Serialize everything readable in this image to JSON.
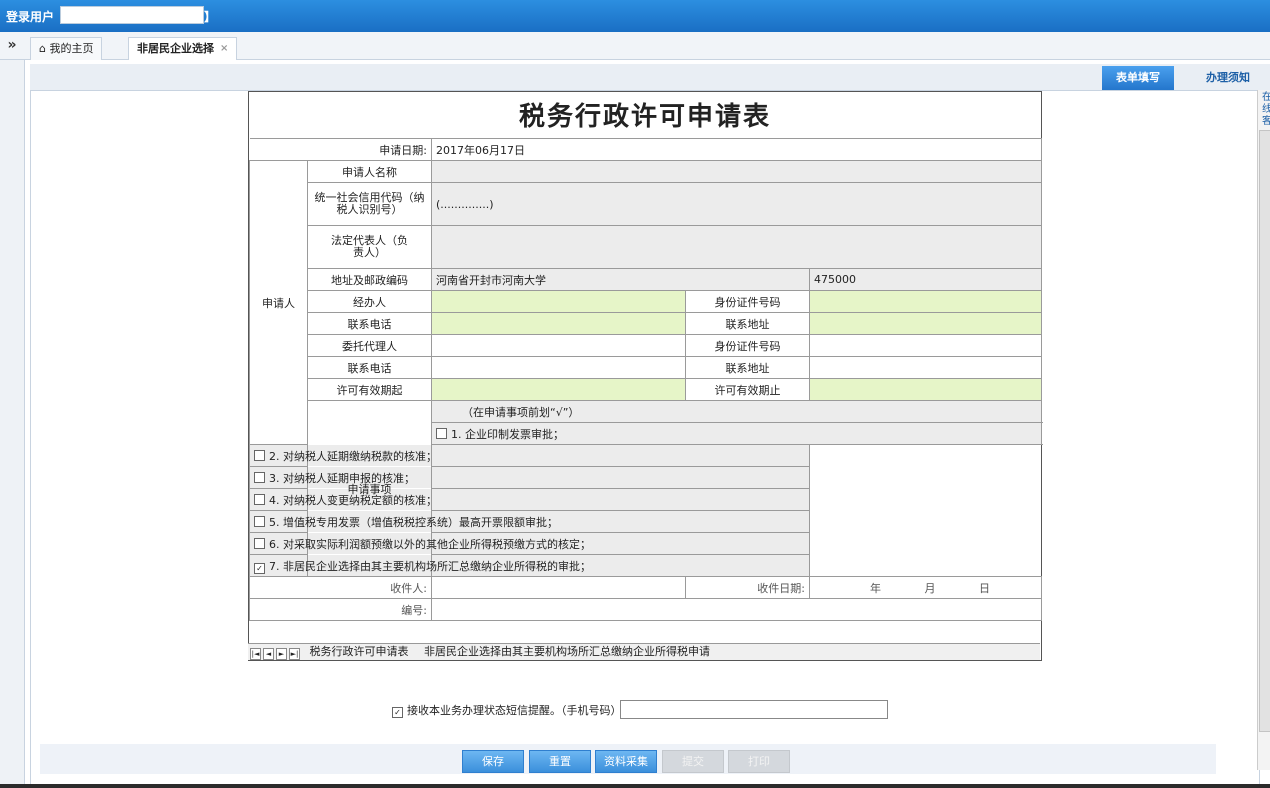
{
  "header": {
    "login_label": "登录用户【",
    "login_close": "】"
  },
  "tabs": [
    {
      "label": "我的主页",
      "icon": "home-icon"
    },
    {
      "label": "非居民企业选择",
      "close": "×"
    }
  ],
  "collapse_glyph": "»",
  "subtabs": [
    {
      "label": "表单填写"
    },
    {
      "label": "办理须知"
    }
  ],
  "side_cut": "在线客",
  "form": {
    "title": "税务行政许可申请表",
    "date_label": "申请日期:",
    "date_value": "2017年06月17日",
    "applicant_section": "申请人",
    "name_label": "申请人名称",
    "credit_label": "统一社会信用代码（纳税人识别号）",
    "credit_value": "(..............)",
    "legal_label": "法定代表人（负责人）",
    "address_label": "地址及邮政编码",
    "address_value": "河南省开封市河南大学",
    "postcode": "475000",
    "handler_label": "经办人",
    "id_label": "身份证件号码",
    "phone_label": "联系电话",
    "contact_addr_label": "联系地址",
    "agent_label": "委托代理人",
    "id_label2": "身份证件号码",
    "phone_label2": "联系电话",
    "contact_addr_label2": "联系地址",
    "valid_from_label": "许可有效期起",
    "valid_to_label": "许可有效期止",
    "matters_section": "申请事项",
    "matters_hint": "（在申请事项前划“√”）",
    "items": [
      {
        "text": "1. 企业印制发票审批；",
        "checked": false
      },
      {
        "text": "2. 对纳税人延期缴纳税款的核准；",
        "checked": false
      },
      {
        "text": "3. 对纳税人延期申报的核准；",
        "checked": false
      },
      {
        "text": "4. 对纳税人变更纳税定额的核准；",
        "checked": false
      },
      {
        "text": "5. 增值税专用发票（增值税税控系统）最高开票限额审批；",
        "checked": false
      },
      {
        "text": "6. 对采取实际利润额预缴以外的其他企业所得税预缴方式的核定；",
        "checked": false
      },
      {
        "text": "7. 非居民企业选择由其主要机构场所汇总缴纳企业所得税的审批；",
        "checked": true
      }
    ],
    "receiver_label": "收件人:",
    "receive_date_label": "收件日期:",
    "year": "年",
    "month": "月",
    "day": "日",
    "number_label": "编号:"
  },
  "sheet_tabs": [
    "税务行政许可申请表",
    "非居民企业选择由其主要机构场所汇总缴纳企业所得税申请"
  ],
  "sms": {
    "label": "接收本业务办理状态短信提醒。（手机号码）",
    "checked": true
  },
  "buttons": [
    {
      "label": "保存",
      "enabled": true
    },
    {
      "label": "重置",
      "enabled": true
    },
    {
      "label": "资料采集",
      "enabled": true
    },
    {
      "label": "提交",
      "enabled": false
    },
    {
      "label": "打印",
      "enabled": false
    }
  ],
  "colors": {
    "header_blue": "#1a6fc4",
    "editable_green": "#e6f5c8",
    "readonly_gray": "#ececec"
  }
}
